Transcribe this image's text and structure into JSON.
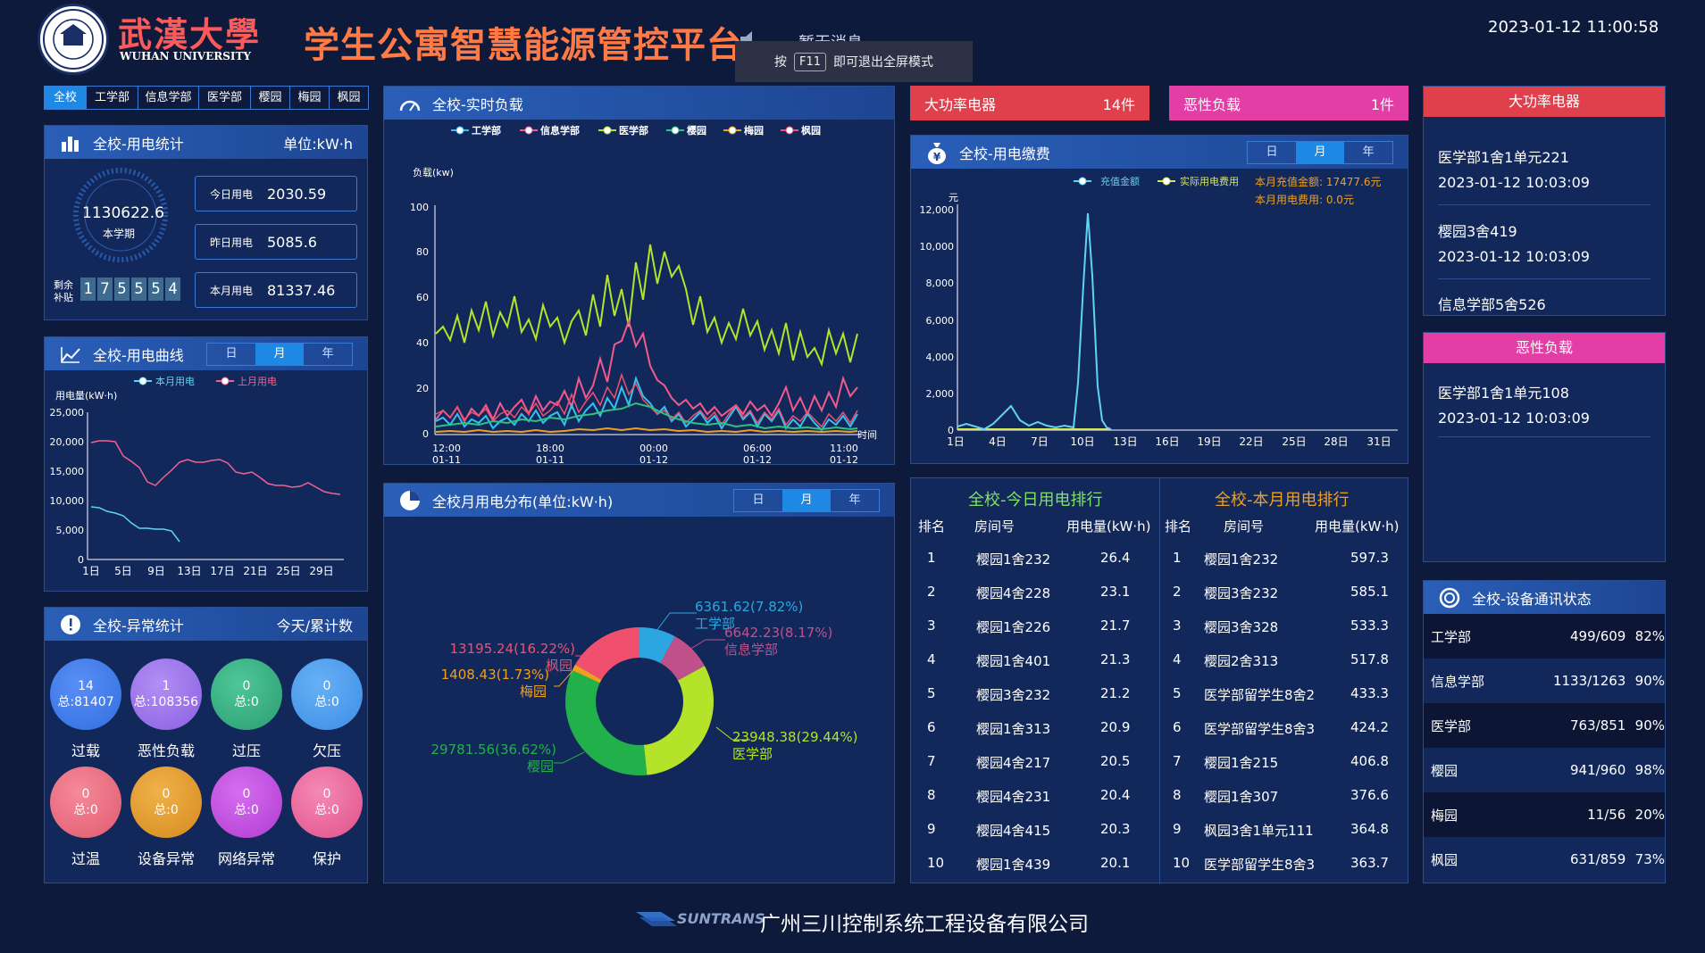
{
  "header": {
    "logo_cn": "武漢大學",
    "logo_en": "WUHAN UNIVERSITY",
    "title": "学生公寓智慧能源管控平台",
    "message": "暂无消息",
    "datetime": "2023-01-12 11:00:58",
    "fullscreen_hint_pre": "按",
    "fullscreen_key": "F11",
    "fullscreen_hint_post": "即可退出全屏模式"
  },
  "tabs": [
    "全校",
    "工学部",
    "信息学部",
    "医学部",
    "樱园",
    "梅园",
    "枫园"
  ],
  "stats": {
    "title": "全校-用电统计",
    "unit": "单位:kW·h",
    "total": "1130622.6",
    "total_label": "本学期",
    "subsidy_label_1": "剩余",
    "subsidy_label_2": "补贴",
    "subsidy_digits": [
      "1",
      "7",
      "5",
      "5",
      "5",
      "4"
    ],
    "rows": [
      {
        "label": "今日用电",
        "value": "2030.59"
      },
      {
        "label": "昨日用电",
        "value": "5085.6"
      },
      {
        "label": "本月用电",
        "value": "81337.46"
      }
    ]
  },
  "curve": {
    "title": "全校-用电曲线",
    "seg": [
      "日",
      "月",
      "年"
    ],
    "legend": [
      "本月用电",
      "上月用电"
    ],
    "ylabel": "用电量(kW·h)",
    "yticks": [
      "25,000",
      "20,000",
      "15,000",
      "10,000",
      "5,000",
      "0"
    ],
    "xticks": [
      "1日",
      "5日",
      "9日",
      "13日",
      "17日",
      "21日",
      "25日",
      "29日"
    ],
    "colors": {
      "this": "#5fd3f3",
      "last": "#f06292"
    }
  },
  "abnormal": {
    "title": "全校-异常统计",
    "right": "今天/累计数",
    "items": [
      {
        "label": "过载",
        "num": "14",
        "total": "总:81407",
        "color": "#2f6fe0"
      },
      {
        "label": "恶性负载",
        "num": "1",
        "total": "总:108356",
        "color": "#8a5fe0"
      },
      {
        "label": "过压",
        "num": "0",
        "total": "总:0",
        "color": "#2a9d6e"
      },
      {
        "label": "欠压",
        "num": "0",
        "total": "总:0",
        "color": "#3a8ee6"
      },
      {
        "label": "过温",
        "num": "0",
        "total": "总:0",
        "color": "#e05a6e"
      },
      {
        "label": "设备异常",
        "num": "0",
        "total": "总:0",
        "color": "#d48a1e"
      },
      {
        "label": "网络异常",
        "num": "0",
        "total": "总:0",
        "color": "#b13bd0"
      },
      {
        "label": "保护",
        "num": "0",
        "total": "总:0",
        "color": "#e0508a"
      }
    ]
  },
  "realtime": {
    "title": "全校-实时负载",
    "legend": [
      {
        "name": "工学部",
        "color": "#35c0f0"
      },
      {
        "name": "信息学部",
        "color": "#f25a8c"
      },
      {
        "name": "医学部",
        "color": "#b5e32a"
      },
      {
        "name": "樱园",
        "color": "#2ec27e"
      },
      {
        "name": "梅园",
        "color": "#f0a020"
      },
      {
        "name": "枫园",
        "color": "#f0506e"
      }
    ],
    "ylabel": "负载(kw)",
    "xlabel": "时间",
    "yticks": [
      "100",
      "80",
      "60",
      "40",
      "20",
      "0"
    ],
    "xticks": [
      [
        "12:00",
        "01-11"
      ],
      [
        "18:00",
        "01-11"
      ],
      [
        "00:00",
        "01-12"
      ],
      [
        "06:00",
        "01-12"
      ],
      [
        "11:00",
        "01-12"
      ]
    ]
  },
  "distribution": {
    "title": "全校月用电分布(单位:kW·h)",
    "seg": [
      "日",
      "月",
      "年"
    ],
    "items": [
      {
        "label": "6361.62(7.82%)",
        "name": "工学部",
        "color": "#2ca6e0"
      },
      {
        "label": "6642.23(8.17%)",
        "name": "信息学部",
        "color": "#c0508a"
      },
      {
        "label": "23948.38(29.44%)",
        "name": "医学部",
        "color": "#b5e32a"
      },
      {
        "label": "29781.56(36.62%)",
        "name": "樱园",
        "color": "#22b04b"
      },
      {
        "label": "1408.43(1.73%)",
        "name": "梅园",
        "color": "#f0a020"
      },
      {
        "label": "13195.24(16.22%)",
        "name": "枫园",
        "color": "#f0506e"
      }
    ]
  },
  "alerts": {
    "high_power": {
      "label": "大功率电器",
      "count": "14件"
    },
    "malicious": {
      "label": "恶性负载",
      "count": "1件"
    }
  },
  "payment": {
    "title": "全校-用电缴费",
    "seg": [
      "日",
      "月",
      "年"
    ],
    "legend": [
      "充值金额",
      "实际用电费用"
    ],
    "info1": "本月充值金额:  17477.6元",
    "info2": "本月用电费用:  0.0元",
    "yunit": "元",
    "yticks": [
      "12,000",
      "10,000",
      "8,000",
      "6,000",
      "4,000",
      "2,000",
      "0"
    ],
    "xticks": [
      "1日",
      "4日",
      "7日",
      "10日",
      "13日",
      "16日",
      "19日",
      "22日",
      "25日",
      "28日",
      "31日"
    ]
  },
  "ranking": {
    "today_title": "全校-今日用电排行",
    "month_title": "全校-本月用电排行",
    "headers": [
      "排名",
      "房间号",
      "用电量(kW·h)"
    ],
    "today": [
      [
        "1",
        "樱园1舍232",
        "26.4"
      ],
      [
        "2",
        "樱园4舍228",
        "23.1"
      ],
      [
        "3",
        "樱园1舍226",
        "21.7"
      ],
      [
        "4",
        "樱园1舍401",
        "21.3"
      ],
      [
        "5",
        "樱园3舍232",
        "21.2"
      ],
      [
        "6",
        "樱园1舍313",
        "20.9"
      ],
      [
        "7",
        "樱园4舍217",
        "20.5"
      ],
      [
        "8",
        "樱园4舍231",
        "20.4"
      ],
      [
        "9",
        "樱园4舍415",
        "20.3"
      ],
      [
        "10",
        "樱园1舍439",
        "20.1"
      ]
    ],
    "month": [
      [
        "1",
        "樱园1舍232",
        "597.3"
      ],
      [
        "2",
        "樱园3舍232",
        "585.1"
      ],
      [
        "3",
        "樱园3舍328",
        "533.3"
      ],
      [
        "4",
        "樱园2舍313",
        "517.8"
      ],
      [
        "5",
        "医学部留学生8舍2",
        "433.3"
      ],
      [
        "6",
        "医学部留学生8舍3",
        "424.2"
      ],
      [
        "7",
        "樱园1舍215",
        "406.8"
      ],
      [
        "8",
        "樱园1舍307",
        "376.6"
      ],
      [
        "9",
        "枫园3舍1单元111",
        "364.8"
      ],
      [
        "10",
        "医学部留学生8舍3",
        "363.7"
      ]
    ]
  },
  "right_high": {
    "title": "大功率电器",
    "entries": [
      "医学部1舍1单元221",
      "2023-01-12 10:03:09",
      "樱园3舍419",
      "2023-01-12 10:03:09",
      "信息学部5舍526"
    ]
  },
  "right_mal": {
    "title": "恶性负载",
    "entries": [
      "医学部1舍1单元108",
      "2023-01-12 10:03:09"
    ]
  },
  "devices": {
    "title": "全校-设备通讯状态",
    "rows": [
      [
        "工学部",
        "499/609",
        "82%"
      ],
      [
        "信息学部",
        "1133/1263",
        "90%"
      ],
      [
        "医学部",
        "763/851",
        "90%"
      ],
      [
        "樱园",
        "941/960",
        "98%"
      ],
      [
        "梅园",
        "11/56",
        "20%"
      ],
      [
        "枫园",
        "631/859",
        "73%"
      ]
    ]
  },
  "footer": {
    "brand": "SUNTRANS",
    "company": "广州三川控制系统工程设备有限公司"
  }
}
